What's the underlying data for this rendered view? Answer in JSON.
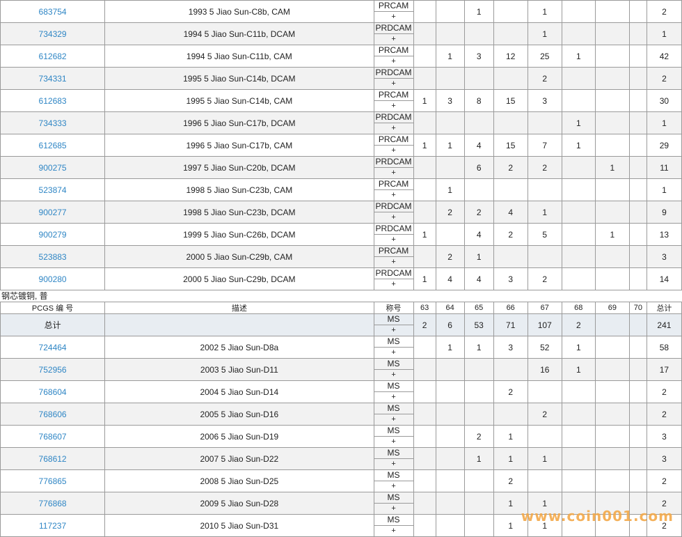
{
  "sectionA": {
    "rows": [
      {
        "id": "683754",
        "desc": "1993 5 Jiao Sun-C8b, CAM",
        "des": "PRCAM",
        "plus": "+",
        "g63": "",
        "g64": "",
        "g65": "1",
        "g66": "",
        "g67": "1",
        "g68": "",
        "g69": "",
        "g70": "",
        "total": "2"
      },
      {
        "id": "734329",
        "desc": "1994 5 Jiao Sun-C11b, DCAM",
        "des": "PRDCAM",
        "plus": "+",
        "g63": "",
        "g64": "",
        "g65": "",
        "g66": "",
        "g67": "1",
        "g68": "",
        "g69": "",
        "g70": "",
        "total": "1"
      },
      {
        "id": "612682",
        "desc": "1994 5 Jiao Sun-C11b, CAM",
        "des": "PRCAM",
        "plus": "+",
        "g63": "",
        "g64": "1",
        "g65": "3",
        "g66": "12",
        "g67": "25",
        "g68": "1",
        "g69": "",
        "g70": "",
        "total": "42"
      },
      {
        "id": "734331",
        "desc": "1995 5 Jiao Sun-C14b, DCAM",
        "des": "PRDCAM",
        "plus": "+",
        "g63": "",
        "g64": "",
        "g65": "",
        "g66": "",
        "g67": "2",
        "g68": "",
        "g69": "",
        "g70": "",
        "total": "2"
      },
      {
        "id": "612683",
        "desc": "1995 5 Jiao Sun-C14b, CAM",
        "des": "PRCAM",
        "plus": "+",
        "g63": "1",
        "g64": "3",
        "g65": "8",
        "g66": "15",
        "g67": "3",
        "g68": "",
        "g69": "",
        "g70": "",
        "total": "30"
      },
      {
        "id": "734333",
        "desc": "1996 5 Jiao Sun-C17b, DCAM",
        "des": "PRDCAM",
        "plus": "+",
        "g63": "",
        "g64": "",
        "g65": "",
        "g66": "",
        "g67": "",
        "g68": "1",
        "g69": "",
        "g70": "",
        "total": "1"
      },
      {
        "id": "612685",
        "desc": "1996 5 Jiao Sun-C17b, CAM",
        "des": "PRCAM",
        "plus": "+",
        "g63": "1",
        "g64": "1",
        "g65": "4",
        "g66": "15",
        "g67": "7",
        "g68": "1",
        "g69": "",
        "g70": "",
        "total": "29"
      },
      {
        "id": "900275",
        "desc": "1997 5 Jiao Sun-C20b, DCAM",
        "des": "PRDCAM",
        "plus": "+",
        "g63": "",
        "g64": "",
        "g65": "6",
        "g66": "2",
        "g67": "2",
        "g68": "",
        "g69": "1",
        "g70": "",
        "total": "11"
      },
      {
        "id": "523874",
        "desc": "1998 5 Jiao Sun-C23b, CAM",
        "des": "PRCAM",
        "plus": "+",
        "g63": "",
        "g64": "1",
        "g65": "",
        "g66": "",
        "g67": "",
        "g68": "",
        "g69": "",
        "g70": "",
        "total": "1"
      },
      {
        "id": "900277",
        "desc": "1998 5 Jiao Sun-C23b, DCAM",
        "des": "PRDCAM",
        "plus": "+",
        "g63": "",
        "g64": "2",
        "g65": "2",
        "g66": "4",
        "g67": "1",
        "g68": "",
        "g69": "",
        "g70": "",
        "total": "9"
      },
      {
        "id": "900279",
        "desc": "1999 5 Jiao Sun-C26b, DCAM",
        "des": "PRDCAM",
        "plus": "+",
        "g63": "1",
        "g64": "",
        "g65": "4",
        "g66": "2",
        "g67": "5",
        "g68": "",
        "g69": "1",
        "g70": "",
        "total": "13"
      },
      {
        "id": "523883",
        "desc": "2000 5 Jiao Sun-C29b, CAM",
        "des": "PRCAM",
        "plus": "+",
        "g63": "",
        "g64": "2",
        "g65": "1",
        "g66": "",
        "g67": "",
        "g68": "",
        "g69": "",
        "g70": "",
        "total": "3"
      },
      {
        "id": "900280",
        "desc": "2000 5 Jiao Sun-C29b, DCAM",
        "des": "PRDCAM",
        "plus": "+",
        "g63": "1",
        "g64": "4",
        "g65": "4",
        "g66": "3",
        "g67": "2",
        "g68": "",
        "g69": "",
        "g70": "",
        "total": "14"
      }
    ]
  },
  "sectionB": {
    "label": "钢芯镀铜, 普",
    "headers": {
      "id": "PCGS 编 号",
      "desc": "描述",
      "des": "称号",
      "g63": "63",
      "g64": "64",
      "g65": "65",
      "g66": "66",
      "g67": "67",
      "g68": "68",
      "g69": "69",
      "g70": "70",
      "total": "总计"
    },
    "totalRow": {
      "id": "总计",
      "desc": "",
      "des": "MS",
      "plus": "+",
      "g63": "2",
      "g64": "6",
      "g65": "53",
      "g66": "71",
      "g67": "107",
      "g68": "2",
      "g69": "",
      "g70": "",
      "total": "241"
    },
    "rows": [
      {
        "id": "724464",
        "desc": "2002 5 Jiao Sun-D8a",
        "des": "MS",
        "plus": "+",
        "g63": "",
        "g64": "1",
        "g65": "1",
        "g66": "3",
        "g67": "52",
        "g68": "1",
        "g69": "",
        "g70": "",
        "total": "58"
      },
      {
        "id": "752956",
        "desc": "2003 5 Jiao Sun-D11",
        "des": "MS",
        "plus": "+",
        "g63": "",
        "g64": "",
        "g65": "",
        "g66": "",
        "g67": "16",
        "g68": "1",
        "g69": "",
        "g70": "",
        "total": "17"
      },
      {
        "id": "768604",
        "desc": "2004 5 Jiao Sun-D14",
        "des": "MS",
        "plus": "+",
        "g63": "",
        "g64": "",
        "g65": "",
        "g66": "2",
        "g67": "",
        "g68": "",
        "g69": "",
        "g70": "",
        "total": "2"
      },
      {
        "id": "768606",
        "desc": "2005 5 Jiao Sun-D16",
        "des": "MS",
        "plus": "+",
        "g63": "",
        "g64": "",
        "g65": "",
        "g66": "",
        "g67": "2",
        "g68": "",
        "g69": "",
        "g70": "",
        "total": "2"
      },
      {
        "id": "768607",
        "desc": "2006 5 Jiao Sun-D19",
        "des": "MS",
        "plus": "+",
        "g63": "",
        "g64": "",
        "g65": "2",
        "g66": "1",
        "g67": "",
        "g68": "",
        "g69": "",
        "g70": "",
        "total": "3"
      },
      {
        "id": "768612",
        "desc": "2007 5 Jiao Sun-D22",
        "des": "MS",
        "plus": "+",
        "g63": "",
        "g64": "",
        "g65": "1",
        "g66": "1",
        "g67": "1",
        "g68": "",
        "g69": "",
        "g70": "",
        "total": "3"
      },
      {
        "id": "776865",
        "desc": "2008 5 Jiao Sun-D25",
        "des": "MS",
        "plus": "+",
        "g63": "",
        "g64": "",
        "g65": "",
        "g66": "2",
        "g67": "",
        "g68": "",
        "g69": "",
        "g70": "",
        "total": "2"
      },
      {
        "id": "776868",
        "desc": "2009 5 Jiao Sun-D28",
        "des": "MS",
        "plus": "+",
        "g63": "",
        "g64": "",
        "g65": "",
        "g66": "1",
        "g67": "1",
        "g68": "",
        "g69": "",
        "g70": "",
        "total": "2"
      },
      {
        "id": "117237",
        "desc": "2010 5 Jiao Sun-D31",
        "des": "MS",
        "plus": "+",
        "g63": "",
        "g64": "",
        "g65": "",
        "g66": "1",
        "g67": "1",
        "g68": "",
        "g69": "",
        "g70": "",
        "total": "2"
      }
    ]
  },
  "watermark": "www.coin001.com"
}
